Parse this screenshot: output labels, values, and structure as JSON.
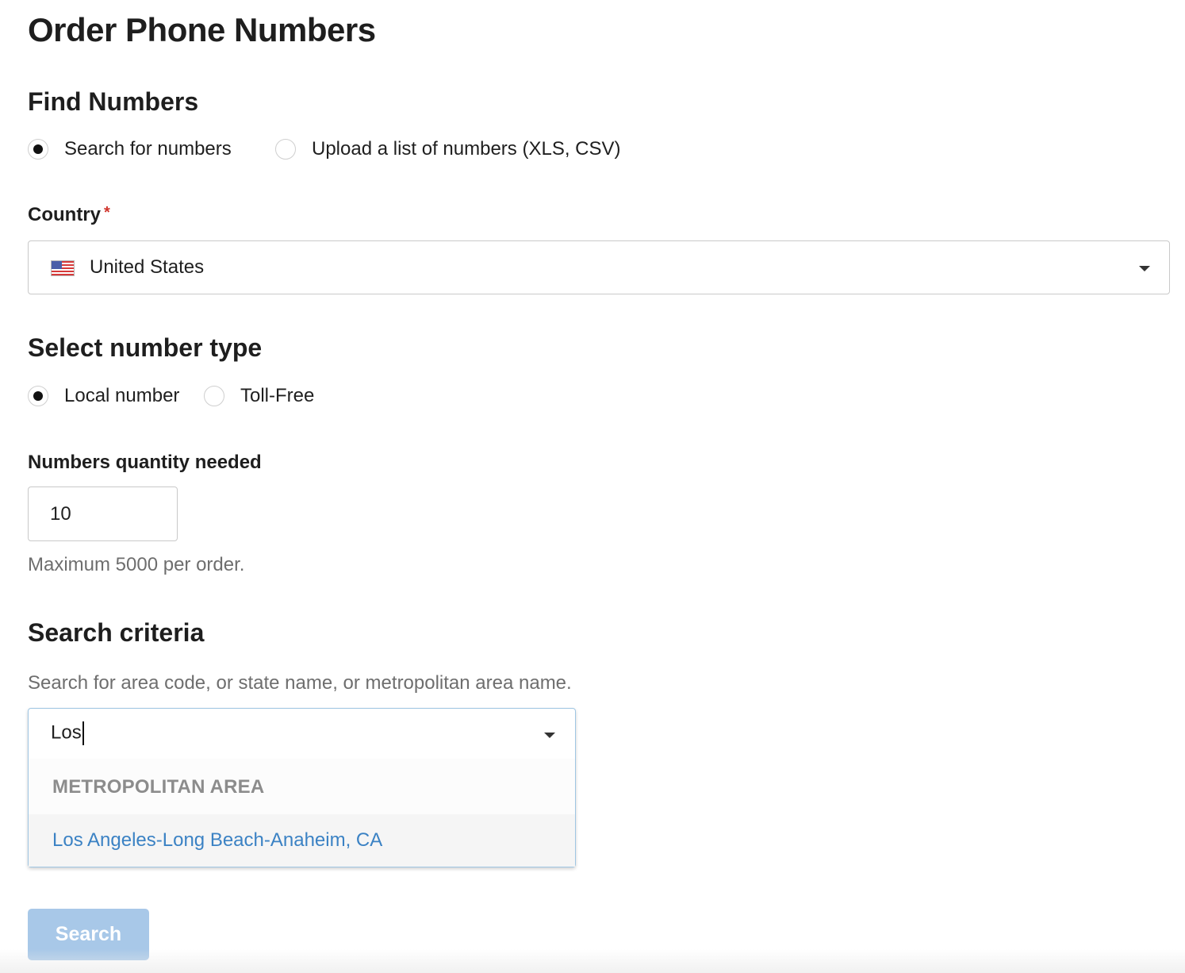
{
  "page": {
    "title": "Order Phone Numbers"
  },
  "find": {
    "heading": "Find Numbers",
    "options": [
      {
        "label": "Search for numbers",
        "selected": true
      },
      {
        "label": "Upload a list of numbers (XLS, CSV)",
        "selected": false
      }
    ]
  },
  "country": {
    "label": "Country",
    "required_mark": "*",
    "value": "United States",
    "flag_icon": "us-flag-icon"
  },
  "number_type": {
    "heading": "Select number type",
    "options": [
      {
        "label": "Local number",
        "selected": true
      },
      {
        "label": "Toll-Free",
        "selected": false
      }
    ]
  },
  "quantity": {
    "label": "Numbers quantity needed",
    "value": "10",
    "hint": "Maximum 5000 per order."
  },
  "criteria": {
    "heading": "Search criteria",
    "help": "Search for area code, or state name, or metropolitan area name.",
    "input_value": "Los",
    "dropdown": {
      "group_header": "METROPOLITAN AREA",
      "options": [
        "Los Angeles-Long Beach-Anaheim, CA"
      ]
    }
  },
  "actions": {
    "search_label": "Search"
  },
  "colors": {
    "link": "#3b82c4",
    "button_disabled": "#a8c8e8",
    "required": "#d0342c",
    "focus_border": "#9fc6e3"
  }
}
